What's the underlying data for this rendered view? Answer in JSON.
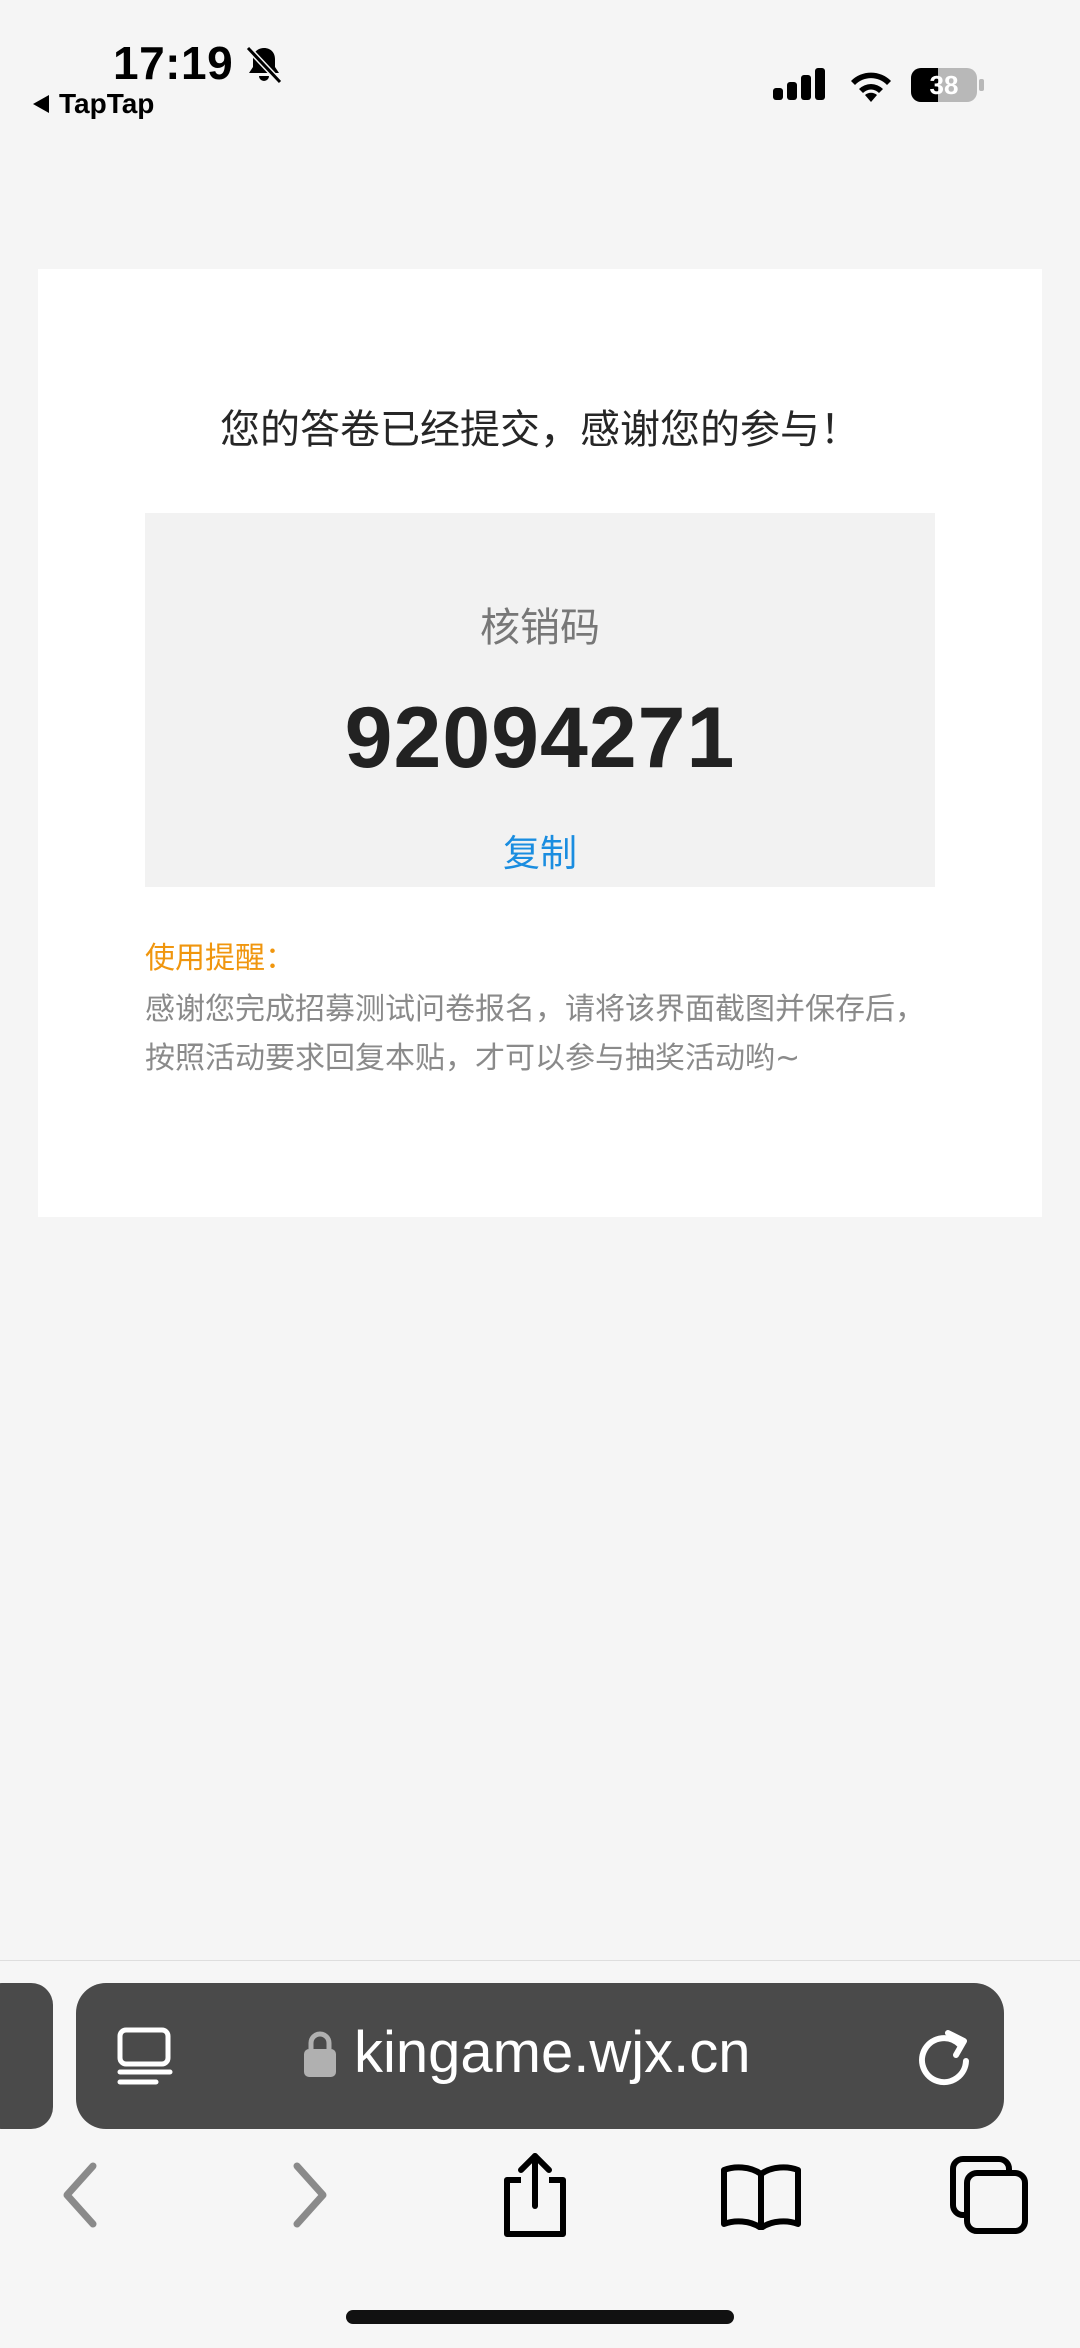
{
  "status_bar": {
    "time": "17:19",
    "back_app": "TapTap",
    "battery": "38"
  },
  "card": {
    "headline": "您的答卷已经提交，感谢您的参与！",
    "code_label": "核销码",
    "code_value": "92094271",
    "copy_label": "复制",
    "tip_title": "使用提醒：",
    "tip_body": "感谢您完成招募测试问卷报名，请将该界面截图并保存后，按照活动要求回复本贴，才可以参与抽奖活动哟~"
  },
  "browser": {
    "url": "kingame.wjx.cn"
  },
  "colors": {
    "copy_link": "#1a8de0",
    "tip_title": "#f0960e",
    "url_bar": "#4a4a4a"
  },
  "icons": [
    "bell-slash-icon",
    "signal-icon",
    "wifi-icon",
    "battery-icon",
    "reader-icon",
    "lock-icon",
    "reload-icon",
    "back-icon",
    "forward-icon",
    "share-icon",
    "bookmarks-icon",
    "tabs-icon"
  ]
}
